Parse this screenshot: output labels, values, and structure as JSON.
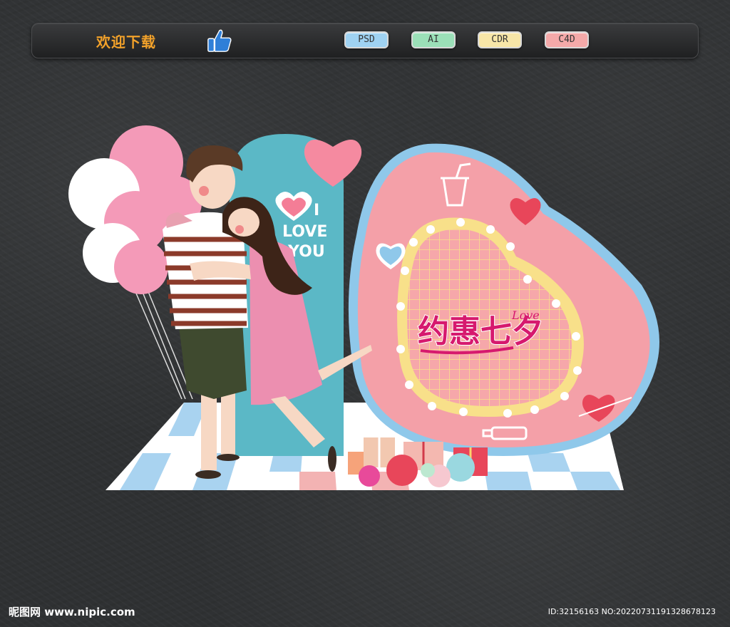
{
  "toolbar": {
    "title": "欢迎下载",
    "formats": [
      "PSD",
      "AI",
      "CDR",
      "C4D"
    ]
  },
  "artwork": {
    "arch_text_line1": "I",
    "arch_text_line2": "LOVE",
    "arch_text_line3": "YOU",
    "heart_title": "约惠七夕",
    "heart_subtitle": "Love"
  },
  "footer": {
    "logo": "昵图网 www.nipic.com",
    "id_text": "ID:32156163 NO:20220731191328678123"
  },
  "colors": {
    "toolbar_title": "#f3a22a",
    "heart_pink": "#f4a0a8",
    "heart_border": "#8fc8ea",
    "arch_teal": "#5bb8c6",
    "title_magenta": "#d6196e"
  },
  "icons": [
    "thumbs-up-icon"
  ]
}
